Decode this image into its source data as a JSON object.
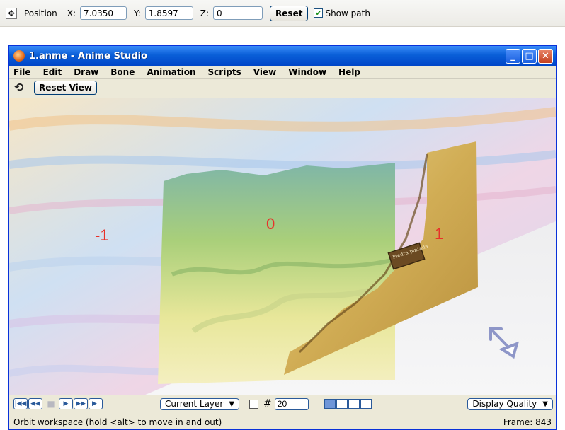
{
  "tool_options": {
    "position_label": "Position",
    "x_label": "X:",
    "x_value": "7.0350",
    "y_label": "Y:",
    "y_value": "1.8597",
    "z_label": "Z:",
    "z_value": "0",
    "reset_label": "Reset",
    "show_path_label": "Show path",
    "show_path_checked": true
  },
  "window": {
    "title": "1.anme - Anime Studio",
    "controls": [
      "minimize",
      "maximize",
      "close"
    ]
  },
  "menu": {
    "items": [
      "File",
      "Edit",
      "Draw",
      "Bone",
      "Animation",
      "Scripts",
      "View",
      "Window",
      "Help"
    ]
  },
  "view_toolbar": {
    "reset_view_label": "Reset View"
  },
  "canvas": {
    "layer_labels": [
      "-1",
      "0",
      "1"
    ],
    "sign_text": "Piedra pintada",
    "label_color": "#e8312a",
    "handle_color": "#8e96c8"
  },
  "playback": {
    "buttons": [
      "rewind-start",
      "step-back",
      "stop",
      "play",
      "step-forward",
      "forward-end"
    ],
    "layer_select": "Current Layer",
    "grid_size": "20",
    "display_quality": "Display Quality"
  },
  "status": {
    "hint": "Orbit workspace (hold <alt> to move in and out)",
    "frame": "Frame: 843"
  }
}
